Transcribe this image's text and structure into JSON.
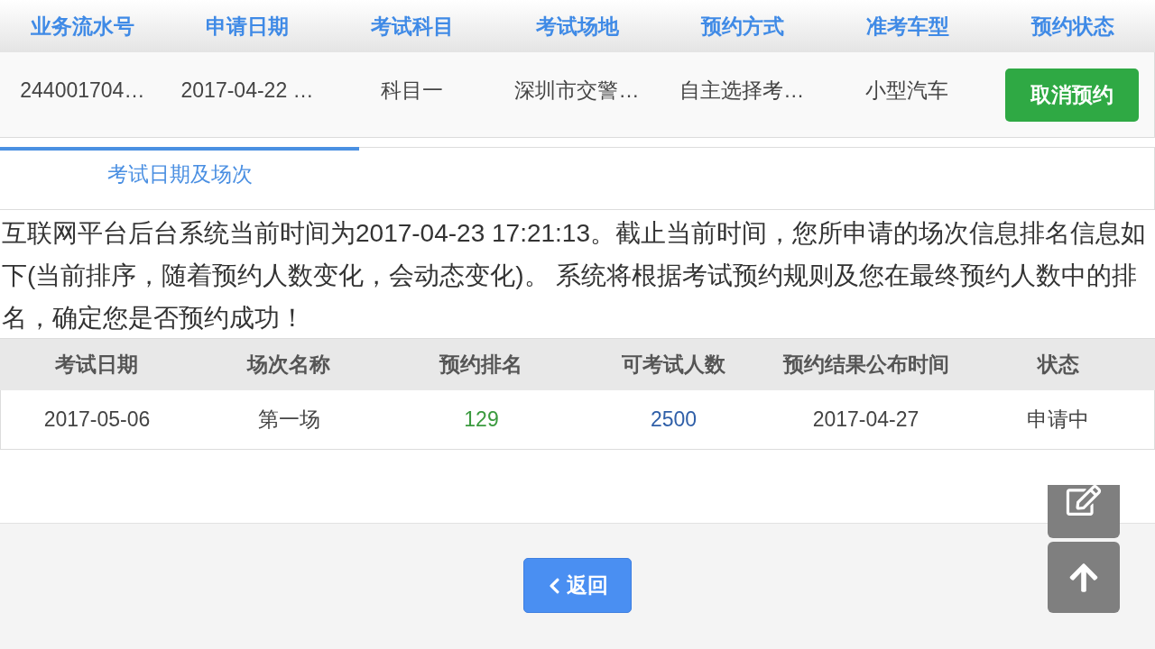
{
  "booking_table": {
    "columns": [
      "业务流水号",
      "申请日期",
      "考试科目",
      "考试场地",
      "预约方式",
      "准考车型",
      "预约状态"
    ],
    "rows": [
      {
        "cells": [
          "244001704…",
          "2017-04-22 …",
          "科目一",
          "深圳市交警…",
          "自主选择考…",
          "小型汽车"
        ],
        "action": "取消预约"
      }
    ]
  },
  "tabs": [
    {
      "label": "考试日期及场次",
      "selected": true
    }
  ],
  "notice": "互联网平台后台系统当前时间为2017-04-23 17:21:13。截止当前时间，您所申请的场次信息排名信息如下(当前排序，随着预约人数变化，会动态变化)。 系统将根据考试预约规则及您在最终预约人数中的排名，确定您是否预约成功！",
  "session_table": {
    "columns": [
      "考试日期",
      "场次名称",
      "预约排名",
      "可考试人数",
      "预约结果公布时间",
      "状态"
    ],
    "rows": [
      {
        "cells": [
          {
            "text": "2017-05-06"
          },
          {
            "text": "第一场"
          },
          {
            "text": "129",
            "color": "#3a9a3e"
          },
          {
            "text": "2500",
            "color": "#2f5fa8"
          },
          {
            "text": "2017-04-27"
          },
          {
            "text": "申请中"
          }
        ]
      }
    ]
  },
  "footer": {
    "back_button": "返回"
  }
}
